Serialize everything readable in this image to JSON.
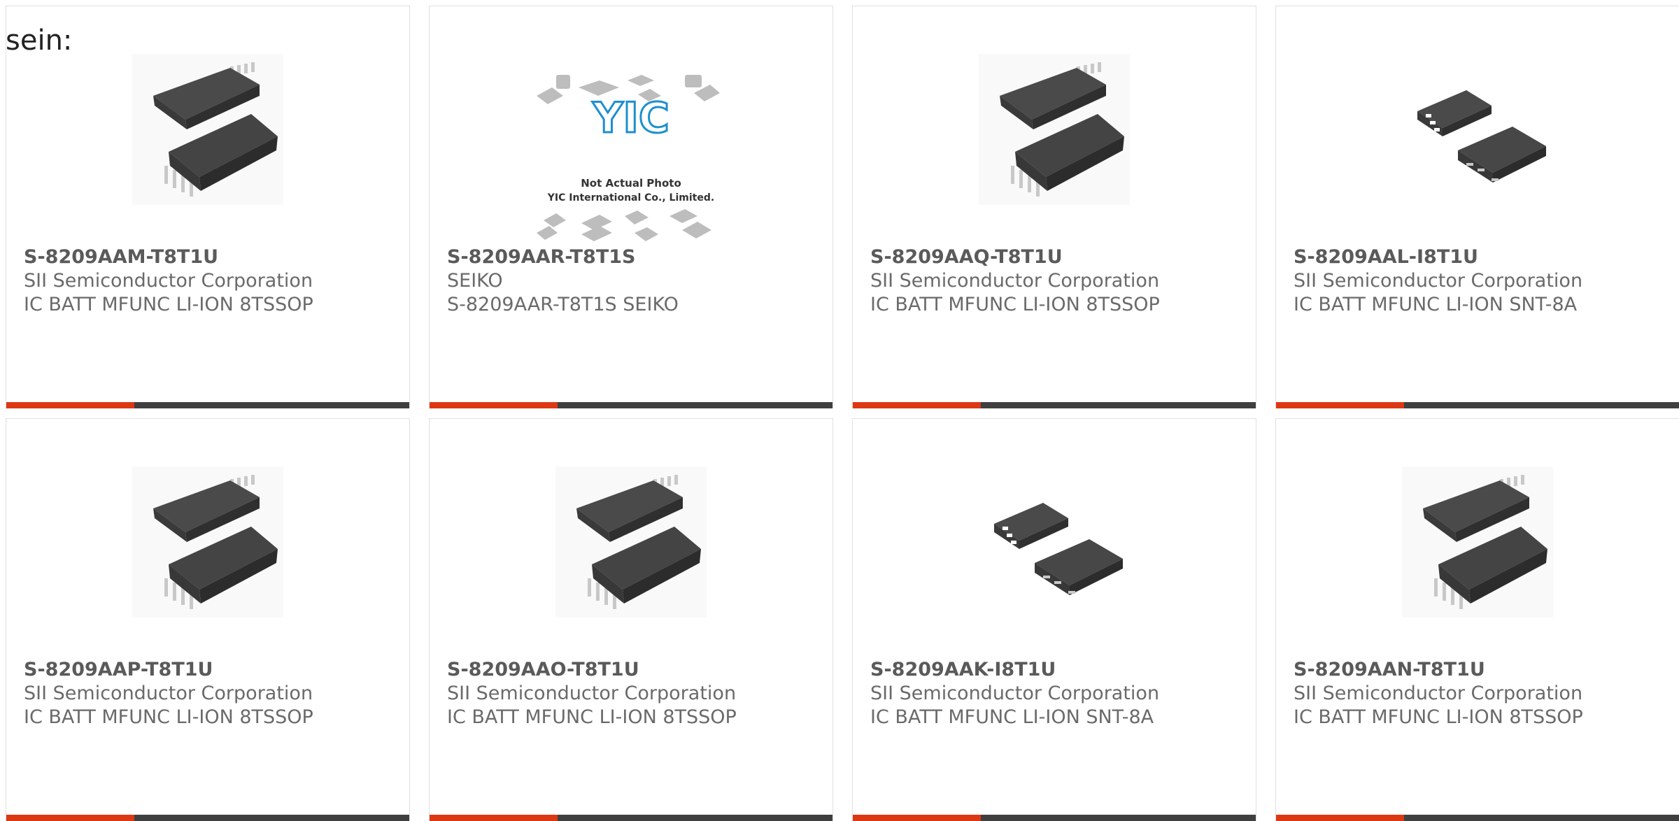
{
  "intro_text": "sein:",
  "colors": {
    "accent": "#dd3814",
    "bar": "#3f3f3f",
    "chip": "#3b3b3b",
    "pin": "#c8c8c8",
    "placeholder_blue": "#1e8fd0"
  },
  "products": [
    {
      "part": "S-8209AAM-T8T1U",
      "manufacturer": "SII Semiconductor Corporation",
      "description": "IC BATT MFUNC LI-ION 8TSSOP",
      "image": "tssop-chip-icon"
    },
    {
      "part": "S-8209AAR-T8T1S",
      "manufacturer": "SEIKO",
      "description": "S-8209AAR-T8T1S SEIKO",
      "image": "not-actual-photo-icon",
      "placeholder": {
        "line1": "Not Actual Photo",
        "line2": "YIC International Co., Limited.",
        "logo": "YIC"
      }
    },
    {
      "part": "S-8209AAQ-T8T1U",
      "manufacturer": "SII Semiconductor Corporation",
      "description": "IC BATT MFUNC LI-ION 8TSSOP",
      "image": "tssop-chip-icon"
    },
    {
      "part": "S-8209AAL-I8T1U",
      "manufacturer": "SII Semiconductor Corporation",
      "description": "IC BATT MFUNC LI-ION SNT-8A",
      "image": "snt-chip-icon"
    },
    {
      "part": "S-8209AAP-T8T1U",
      "manufacturer": "SII Semiconductor Corporation",
      "description": "IC BATT MFUNC LI-ION 8TSSOP",
      "image": "tssop-chip-icon"
    },
    {
      "part": "S-8209AAO-T8T1U",
      "manufacturer": "SII Semiconductor Corporation",
      "description": "IC BATT MFUNC LI-ION 8TSSOP",
      "image": "tssop-chip-icon"
    },
    {
      "part": "S-8209AAK-I8T1U",
      "manufacturer": "SII Semiconductor Corporation",
      "description": "IC BATT MFUNC LI-ION SNT-8A",
      "image": "snt-chip-icon"
    },
    {
      "part": "S-8209AAN-T8T1U",
      "manufacturer": "SII Semiconductor Corporation",
      "description": "IC BATT MFUNC LI-ION 8TSSOP",
      "image": "tssop-chip-icon"
    }
  ]
}
